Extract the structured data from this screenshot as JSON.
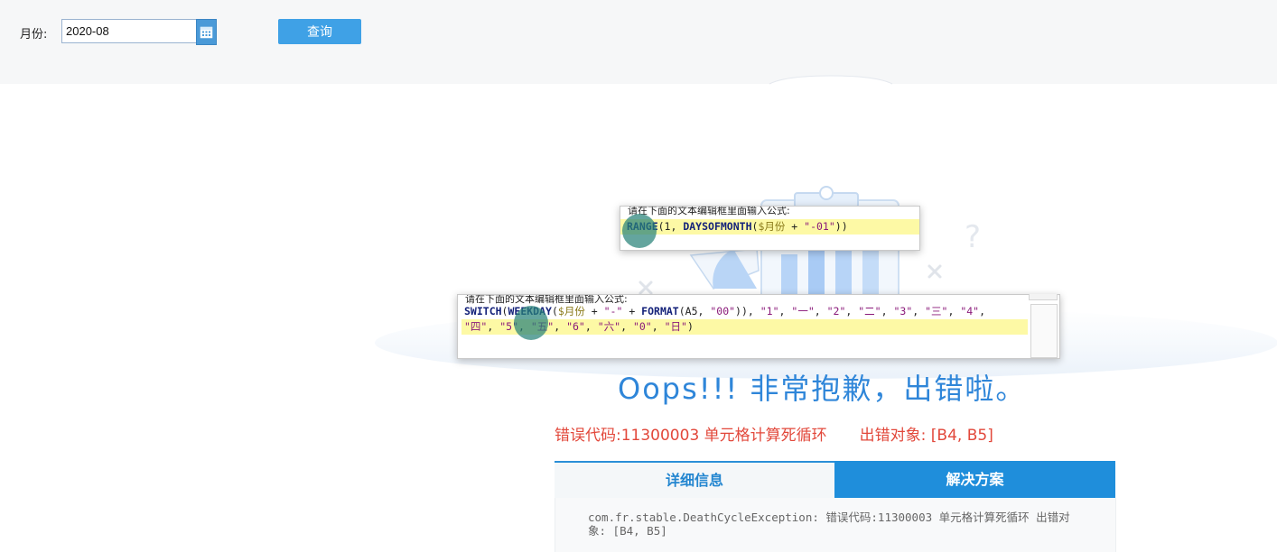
{
  "filter": {
    "month_label": "月份:",
    "month_value": "2020-08",
    "query_label": "查询"
  },
  "editor_top": {
    "hint": "请在下面的文本编辑框里面输入公式:",
    "tokens": [
      {
        "t": "RANGE",
        "c": "fn"
      },
      {
        "t": "(1, ",
        "c": "op"
      },
      {
        "t": "DAYSOFMONTH",
        "c": "fn"
      },
      {
        "t": "(",
        "c": "op"
      },
      {
        "t": "$月份",
        "c": "var"
      },
      {
        "t": " + ",
        "c": "op"
      },
      {
        "t": "\"-01\"",
        "c": "str"
      },
      {
        "t": "))",
        "c": "op"
      }
    ]
  },
  "editor_bottom": {
    "hint": "请在下面的文本编辑框里面输入公式:",
    "line1": [
      {
        "t": "SWITCH",
        "c": "fn"
      },
      {
        "t": "(",
        "c": "op"
      },
      {
        "t": "WEEKDAY",
        "c": "fn"
      },
      {
        "t": "(",
        "c": "op"
      },
      {
        "t": "$月份",
        "c": "var"
      },
      {
        "t": " + ",
        "c": "op"
      },
      {
        "t": "\"-\"",
        "c": "str"
      },
      {
        "t": " + ",
        "c": "op"
      },
      {
        "t": "FORMAT",
        "c": "fn"
      },
      {
        "t": "(A5, ",
        "c": "op"
      },
      {
        "t": "\"00\"",
        "c": "str"
      },
      {
        "t": ")), ",
        "c": "op"
      },
      {
        "t": "\"1\"",
        "c": "str"
      },
      {
        "t": ", ",
        "c": "op"
      },
      {
        "t": "\"一\"",
        "c": "str"
      },
      {
        "t": ", ",
        "c": "op"
      },
      {
        "t": "\"2\"",
        "c": "str"
      },
      {
        "t": ", ",
        "c": "op"
      },
      {
        "t": "\"二\"",
        "c": "str"
      },
      {
        "t": ", ",
        "c": "op"
      },
      {
        "t": "\"3\"",
        "c": "str"
      },
      {
        "t": ", ",
        "c": "op"
      },
      {
        "t": "\"三\"",
        "c": "str"
      },
      {
        "t": ", ",
        "c": "op"
      },
      {
        "t": "\"4\"",
        "c": "str"
      },
      {
        "t": ",",
        "c": "op"
      }
    ],
    "line2": [
      {
        "t": "\"四\"",
        "c": "str"
      },
      {
        "t": ", ",
        "c": "op"
      },
      {
        "t": "\"5\"",
        "c": "str"
      },
      {
        "t": ", ",
        "c": "op"
      },
      {
        "t": "\"五\"",
        "c": "str"
      },
      {
        "t": ", ",
        "c": "op"
      },
      {
        "t": "\"6\"",
        "c": "str"
      },
      {
        "t": ", ",
        "c": "op"
      },
      {
        "t": "\"六\"",
        "c": "str"
      },
      {
        "t": ", ",
        "c": "op"
      },
      {
        "t": "\"0\"",
        "c": "str"
      },
      {
        "t": ", ",
        "c": "op"
      },
      {
        "t": "\"日\"",
        "c": "str"
      },
      {
        "t": ")",
        "c": "op"
      }
    ]
  },
  "error": {
    "title": "Oops!!! 非常抱歉，出错啦。",
    "code_text": "错误代码:11300003 单元格计算死循环",
    "target_text": "出错对象:  [B4, B5]",
    "tab_detail": "详细信息",
    "tab_solution": "解决方案",
    "detail": "com.fr.stable.DeathCycleException: 错误代码:11300003 单元格计算死循环    出错对象:  [B4, B5]"
  },
  "colors": {
    "accent_blue": "#2f86d9",
    "error_red": "#e2483b",
    "tab_active_bg": "#1f8edb",
    "editor_highlight": "#fdf9a5"
  },
  "icons": [
    "calendar-icon",
    "clipboard-illustration",
    "question-mark-icon",
    "cross-mark-icon"
  ]
}
